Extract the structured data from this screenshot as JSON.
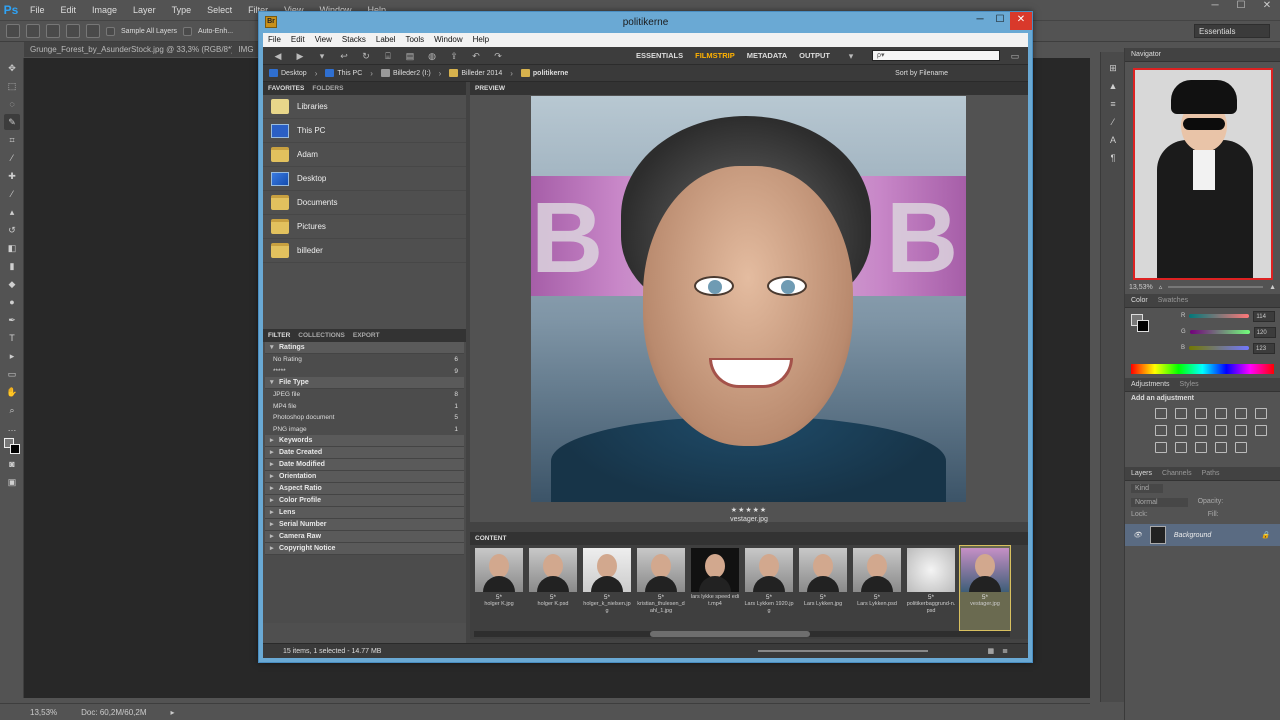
{
  "ps": {
    "menu": [
      "File",
      "Edit",
      "Image",
      "Layer",
      "Type",
      "Select",
      "Filter",
      "View",
      "Window",
      "Help"
    ],
    "options": {
      "sample_all_layers": "Sample All Layers",
      "auto_enhance": "Auto-Enh..."
    },
    "workspace": "Essentials",
    "doc_tabs": [
      "Grunge_Forest_by_AsunderStock.jpg @ 33,3% (RGB/8*)",
      "IMG"
    ],
    "status": {
      "zoom": "13,53%",
      "doc": "Doc: 60,2M/60,2M"
    },
    "navigator": {
      "tab": "Navigator",
      "zoom": "13,53%"
    },
    "color": {
      "tabs": [
        "Color",
        "Swatches"
      ],
      "r_label": "R",
      "g_label": "G",
      "b_label": "B",
      "r": "114",
      "g": "120",
      "b": "123"
    },
    "adjustments": {
      "tabs": [
        "Adjustments",
        "Styles"
      ],
      "hint": "Add an adjustment"
    },
    "layers": {
      "tabs": [
        "Layers",
        "Channels",
        "Paths"
      ],
      "kind": "Kind",
      "blend": "Normal",
      "opacity_label": "Opacity:",
      "lock_label": "Lock:",
      "fill_label": "Fill:",
      "layer_name": "Background"
    }
  },
  "bridge": {
    "title": "politikerne",
    "menu": [
      "File",
      "Edit",
      "View",
      "Stacks",
      "Label",
      "Tools",
      "Window",
      "Help"
    ],
    "workspaces": [
      "ESSENTIALS",
      "FILMSTRIP",
      "METADATA",
      "OUTPUT"
    ],
    "active_workspace": "FILMSTRIP",
    "search_placeholder": "ρ▾",
    "breadcrumbs": [
      "Desktop",
      "This PC",
      "Billeder2 (I:)",
      "Billeder 2014",
      "politikerne"
    ],
    "sort": "Sort by Filename",
    "favorites_tabs": [
      "FAVORITES",
      "FOLDERS"
    ],
    "favorites": [
      "Libraries",
      "This PC",
      "Adam",
      "Desktop",
      "Documents",
      "Pictures",
      "billeder"
    ],
    "filter_tabs": [
      "FILTER",
      "COLLECTIONS",
      "EXPORT"
    ],
    "filter": {
      "ratings": {
        "label": "Ratings",
        "rows": [
          {
            "name": "No Rating",
            "count": "6"
          },
          {
            "name": "*****",
            "count": "9"
          }
        ]
      },
      "file_type": {
        "label": "File Type",
        "rows": [
          {
            "name": "JPEG file",
            "count": "8"
          },
          {
            "name": "MP4 file",
            "count": "1"
          },
          {
            "name": "Photoshop document",
            "count": "5"
          },
          {
            "name": "PNG image",
            "count": "1"
          }
        ]
      },
      "collapsed": [
        "Keywords",
        "Date Created",
        "Date Modified",
        "Orientation",
        "Aspect Ratio",
        "Color Profile",
        "Lens",
        "Serial Number",
        "Camera Raw",
        "Copyright Notice"
      ]
    },
    "preview_tab": "PREVIEW",
    "preview_letters": [
      "B",
      "B"
    ],
    "preview_stars": "★★★★★",
    "preview_file": "vestager.jpg",
    "content_tab": "CONTENT",
    "thumbnails": [
      {
        "name": "holger K.jpg",
        "stars": "5*",
        "kind": "photo"
      },
      {
        "name": "holger K.psd",
        "stars": "5*",
        "kind": "photo"
      },
      {
        "name": "holger_k_nielsen.jpg",
        "stars": "5*",
        "kind": "photo"
      },
      {
        "name": "kristian_thulesen_dahl_1.jpg",
        "stars": "5*",
        "kind": "photo"
      },
      {
        "name": "lars lykke speed edit.mp4",
        "stars": "",
        "kind": "video"
      },
      {
        "name": "Lars Lykken 1920.jpg",
        "stars": "5*",
        "kind": "photo"
      },
      {
        "name": "Lars Lykken.jpg",
        "stars": "5*",
        "kind": "photo"
      },
      {
        "name": "Lars Lykken.psd",
        "stars": "5*",
        "kind": "photo"
      },
      {
        "name": "politikerbaggrund-n.psd",
        "stars": "5*",
        "kind": "blank"
      },
      {
        "name": "vestager.jpg",
        "stars": "5*",
        "kind": "selected"
      }
    ],
    "status": "15 items, 1 selected - 14.77 MB"
  }
}
